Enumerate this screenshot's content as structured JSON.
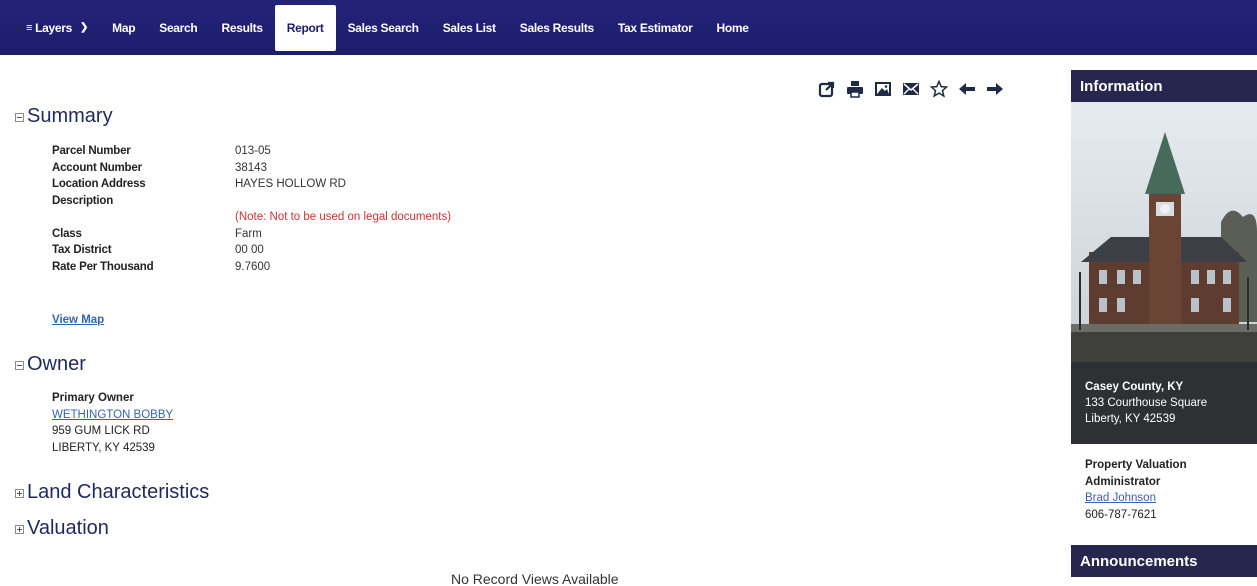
{
  "nav": {
    "layers": "Layers",
    "items": [
      "Map",
      "Search",
      "Results",
      "Report",
      "Sales Search",
      "Sales List",
      "Sales Results",
      "Tax Estimator",
      "Home"
    ],
    "active": "Report"
  },
  "toolbar": {
    "icons": [
      "share-icon",
      "print-icon",
      "image-icon",
      "email-icon",
      "star-icon",
      "arrow-left-icon",
      "arrow-right-icon"
    ]
  },
  "sections": {
    "summary": "Summary",
    "owner": "Owner",
    "land": "Land Characteristics",
    "valuation": "Valuation"
  },
  "summary": {
    "parcel_label": "Parcel Number",
    "parcel_value": "013-05",
    "account_label": "Account Number",
    "account_value": "38143",
    "location_label": "Location Address",
    "location_value": "HAYES HOLLOW RD",
    "description_label": "Description",
    "note": "(Note: Not to be used on legal documents)",
    "class_label": "Class",
    "class_value": "Farm",
    "district_label": "Tax District",
    "district_value": "00 00",
    "rate_label": "Rate Per Thousand",
    "rate_value": "9.7600",
    "view_map": "View Map"
  },
  "owner": {
    "label": "Primary Owner",
    "name": "WETHINGTON BOBBY",
    "street": "959 GUM LICK RD",
    "city": "LIBERTY, KY 42539"
  },
  "no_records": "No Record Views Available",
  "sidebar": {
    "info_title": "Information",
    "county": "Casey County, KY",
    "street": "133 Courthouse Square",
    "city": "Liberty, KY 42539",
    "pva_line1": "Property Valuation",
    "pva_line2": "Administrator",
    "pva_name": "Brad Johnson",
    "pva_phone": "606-787-7621",
    "announcements_title": "Announcements"
  },
  "colors": {
    "nav_bg": "#1d1d6b",
    "header_text": "#1f2a5a",
    "link": "#3366aa",
    "note": "#cc3333",
    "sidebar_head": "#26264f"
  }
}
